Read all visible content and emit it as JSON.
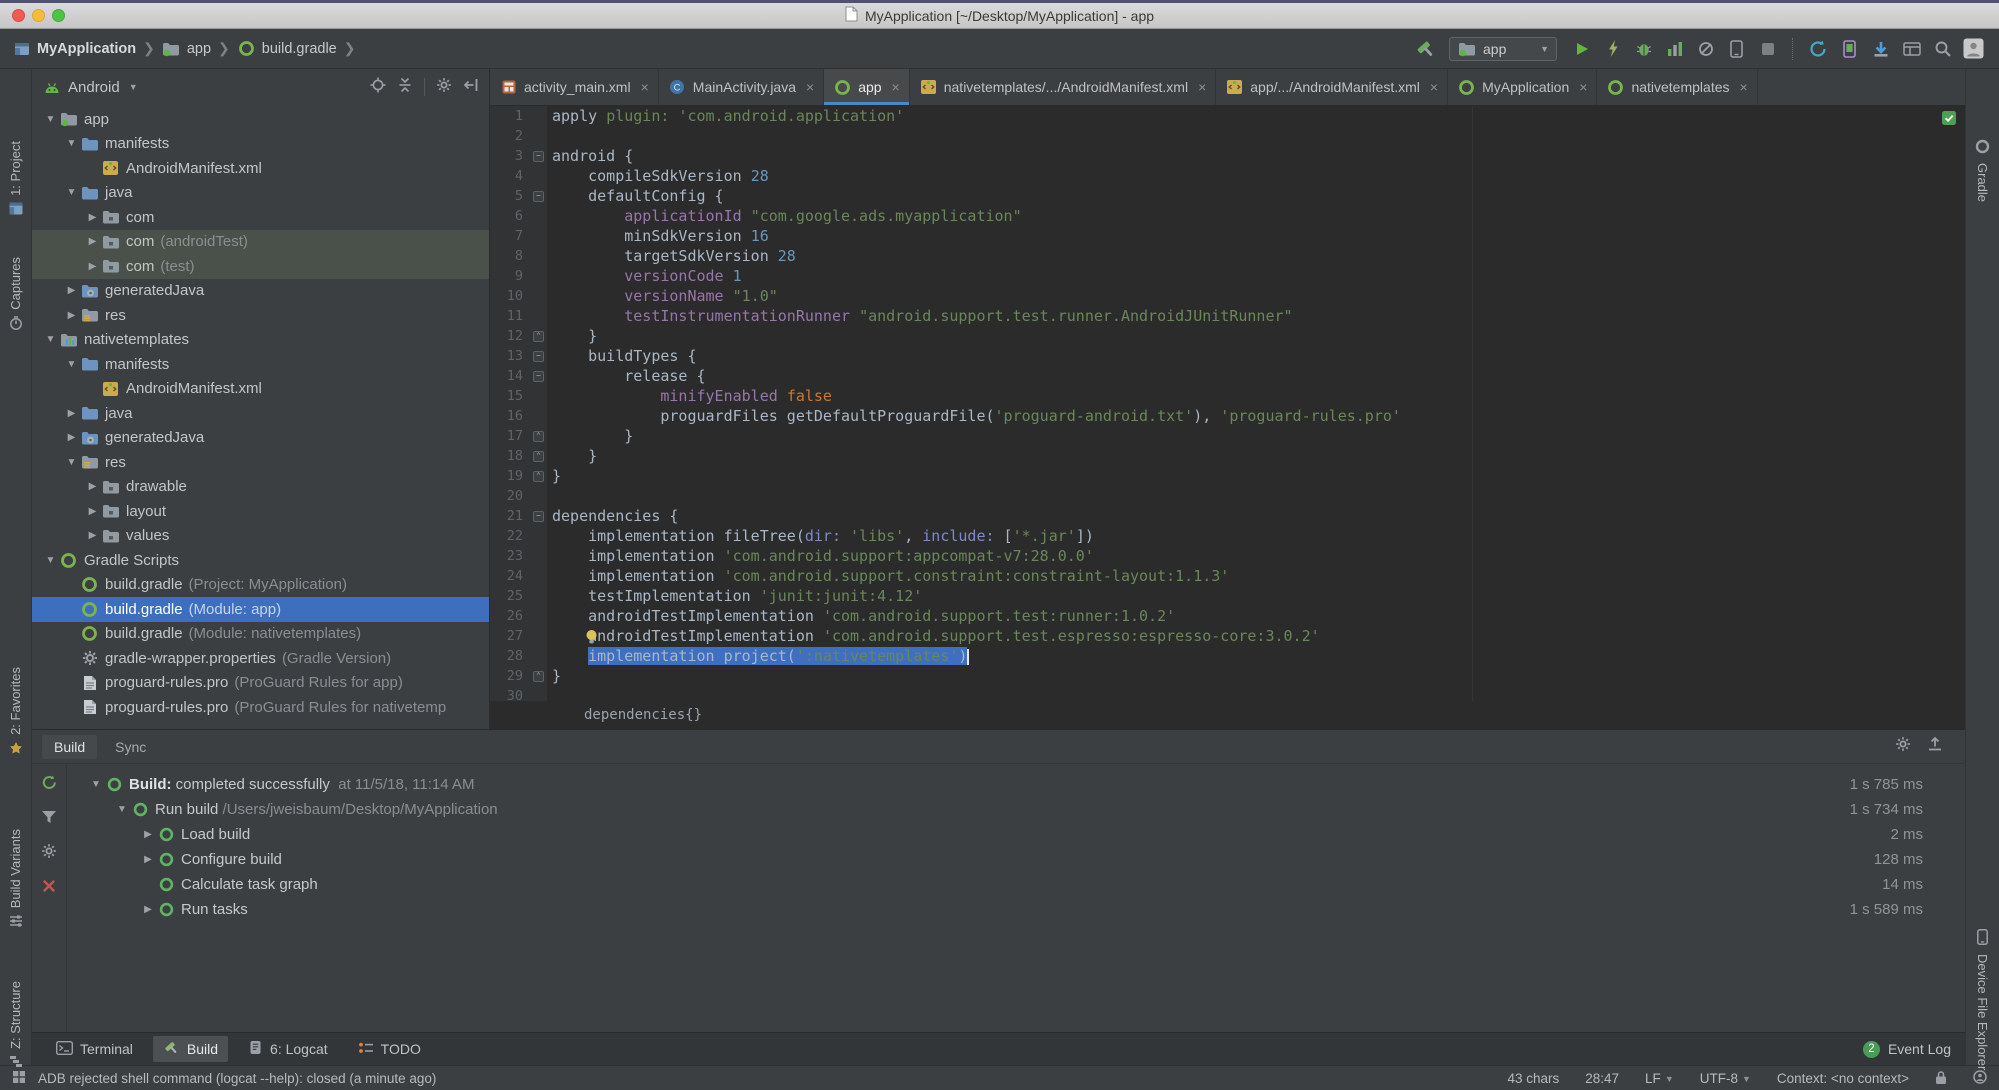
{
  "window": {
    "title": "MyApplication [~/Desktop/MyApplication] - app"
  },
  "toolbar": {
    "breadcrumbs": [
      "MyApplication",
      "app",
      "build.gradle"
    ],
    "run_config": "app",
    "icons": [
      "build-hammer",
      "run-config-selector",
      "run",
      "apply-changes",
      "debug",
      "profile",
      "attach-profiler",
      "select-device",
      "stop",
      "sync-gradle",
      "avd-manager",
      "sdk-manager",
      "project-structure",
      "search-everywhere",
      "user-avatar"
    ]
  },
  "left_stripe": {
    "items": [
      {
        "icon": "project-tool",
        "label": "1: Project"
      },
      {
        "icon": "captures-tool",
        "label": "Captures"
      },
      {
        "icon": "favorites-tool",
        "label": "2: Favorites"
      },
      {
        "icon": "variants-tool",
        "label": "Build Variants"
      },
      {
        "icon": "structure-tool",
        "label": "Z: Structure"
      }
    ]
  },
  "right_stripe": {
    "items": [
      {
        "icon": "gradle-tool",
        "label": "Gradle"
      },
      {
        "icon": "device-tool",
        "label": "Device File Explorer"
      }
    ]
  },
  "project_panel": {
    "view_selector": "Android",
    "tree": [
      {
        "d": 0,
        "a": "v",
        "i": "app",
        "l": "app"
      },
      {
        "d": 1,
        "a": "v",
        "i": "fblue",
        "l": "manifests"
      },
      {
        "d": 2,
        "a": "",
        "i": "manifest",
        "l": "AndroidManifest.xml"
      },
      {
        "d": 1,
        "a": "v",
        "i": "fblue",
        "l": "java"
      },
      {
        "d": 2,
        "a": "r",
        "i": "fpkg",
        "l": "com"
      },
      {
        "d": 2,
        "a": "r",
        "i": "fpkg",
        "l": "com",
        "n": "(androidTest)",
        "soft": true
      },
      {
        "d": 2,
        "a": "r",
        "i": "fpkg",
        "l": "com",
        "n": "(test)",
        "soft": true
      },
      {
        "d": 1,
        "a": "r",
        "i": "fgen",
        "l": "generatedJava"
      },
      {
        "d": 1,
        "a": "r",
        "i": "fres",
        "l": "res"
      },
      {
        "d": 0,
        "a": "v",
        "i": "mod",
        "l": "nativetemplates"
      },
      {
        "d": 1,
        "a": "v",
        "i": "fblue",
        "l": "manifests"
      },
      {
        "d": 2,
        "a": "",
        "i": "manifest",
        "l": "AndroidManifest.xml"
      },
      {
        "d": 1,
        "a": "r",
        "i": "fblue",
        "l": "java"
      },
      {
        "d": 1,
        "a": "r",
        "i": "fgen",
        "l": "generatedJava"
      },
      {
        "d": 1,
        "a": "v",
        "i": "fres",
        "l": "res"
      },
      {
        "d": 2,
        "a": "r",
        "i": "fpkg",
        "l": "drawable"
      },
      {
        "d": 2,
        "a": "r",
        "i": "fpkg",
        "l": "layout"
      },
      {
        "d": 2,
        "a": "r",
        "i": "fpkg",
        "l": "values"
      },
      {
        "d": 0,
        "a": "v",
        "i": "gradle",
        "l": "Gradle Scripts"
      },
      {
        "d": 1,
        "a": "",
        "i": "gradle",
        "l": "build.gradle",
        "n": "(Project: MyApplication)"
      },
      {
        "d": 1,
        "a": "",
        "i": "gradle",
        "l": "build.gradle",
        "n": "(Module: app)",
        "sel": true
      },
      {
        "d": 1,
        "a": "",
        "i": "gradle",
        "l": "build.gradle",
        "n": "(Module: nativetemplates)"
      },
      {
        "d": 1,
        "a": "",
        "i": "props",
        "l": "gradle-wrapper.properties",
        "n": "(Gradle Version)"
      },
      {
        "d": 1,
        "a": "",
        "i": "pro",
        "l": "proguard-rules.pro",
        "n": "(ProGuard Rules for app)"
      },
      {
        "d": 1,
        "a": "",
        "i": "pro",
        "l": "proguard-rules.pro",
        "n": "(ProGuard Rules for nativetemp"
      }
    ]
  },
  "editor": {
    "tabs": [
      {
        "icon": "layout",
        "label": "activity_main.xml"
      },
      {
        "icon": "jclass",
        "label": "MainActivity.java"
      },
      {
        "icon": "gradle",
        "label": "app",
        "selected": true
      },
      {
        "icon": "manifest",
        "label": "nativetemplates/.../AndroidManifest.xml"
      },
      {
        "icon": "manifest",
        "label": "app/.../AndroidManifest.xml"
      },
      {
        "icon": "gradle",
        "label": "MyApplication"
      },
      {
        "icon": "gradle",
        "label": "nativetemplates"
      }
    ],
    "context_line": "dependencies{}",
    "code": {
      "lines": [
        {
          "n": 1,
          "tokens": [
            {
              "t": "apply ",
              "c": "d"
            },
            {
              "t": "plugin:",
              "c": "g"
            },
            {
              "t": " ",
              "c": "d"
            },
            {
              "t": "'com.android.application'",
              "c": "s"
            }
          ]
        },
        {
          "n": 2,
          "tokens": []
        },
        {
          "n": 3,
          "f": "m",
          "tokens": [
            {
              "t": "android {",
              "c": "d"
            }
          ]
        },
        {
          "n": 4,
          "tokens": [
            {
              "t": "    compileSdkVersion ",
              "c": "d"
            },
            {
              "t": "28",
              "c": "n"
            }
          ]
        },
        {
          "n": 5,
          "f": "m",
          "tokens": [
            {
              "t": "    defaultConfig {",
              "c": "d"
            }
          ]
        },
        {
          "n": 6,
          "tokens": [
            {
              "t": "        ",
              "c": "d"
            },
            {
              "t": "applicationId ",
              "c": "p"
            },
            {
              "t": "\"com.google.ads.myapplication\"",
              "c": "s"
            }
          ]
        },
        {
          "n": 7,
          "tokens": [
            {
              "t": "        minSdkVersion ",
              "c": "d"
            },
            {
              "t": "16",
              "c": "n"
            }
          ]
        },
        {
          "n": 8,
          "tokens": [
            {
              "t": "        targetSdkVersion ",
              "c": "d"
            },
            {
              "t": "28",
              "c": "n"
            }
          ]
        },
        {
          "n": 9,
          "tokens": [
            {
              "t": "        ",
              "c": "d"
            },
            {
              "t": "versionCode ",
              "c": "p"
            },
            {
              "t": "1",
              "c": "n"
            }
          ]
        },
        {
          "n": 10,
          "tokens": [
            {
              "t": "        ",
              "c": "d"
            },
            {
              "t": "versionName ",
              "c": "p"
            },
            {
              "t": "\"1.0\"",
              "c": "s"
            }
          ]
        },
        {
          "n": 11,
          "tokens": [
            {
              "t": "        ",
              "c": "d"
            },
            {
              "t": "testInstrumentationRunner ",
              "c": "p"
            },
            {
              "t": "\"android.support.test.runner.AndroidJUnitRunner\"",
              "c": "s"
            }
          ]
        },
        {
          "n": 12,
          "f": "e",
          "tokens": [
            {
              "t": "    }",
              "c": "d"
            }
          ]
        },
        {
          "n": 13,
          "f": "m",
          "tokens": [
            {
              "t": "    buildTypes {",
              "c": "d"
            }
          ]
        },
        {
          "n": 14,
          "f": "m",
          "tokens": [
            {
              "t": "        release {",
              "c": "d"
            }
          ]
        },
        {
          "n": 15,
          "tokens": [
            {
              "t": "            ",
              "c": "d"
            },
            {
              "t": "minifyEnabled ",
              "c": "p"
            },
            {
              "t": "false",
              "c": "k"
            }
          ]
        },
        {
          "n": 16,
          "tokens": [
            {
              "t": "            proguardFiles getDefaultProguardFile(",
              "c": "d"
            },
            {
              "t": "'proguard-android.txt'",
              "c": "s"
            },
            {
              "t": "), ",
              "c": "d"
            },
            {
              "t": "'proguard-rules.pro'",
              "c": "s"
            }
          ]
        },
        {
          "n": 17,
          "f": "e",
          "tokens": [
            {
              "t": "        }",
              "c": "d"
            }
          ]
        },
        {
          "n": 18,
          "f": "e",
          "tokens": [
            {
              "t": "    }",
              "c": "d"
            }
          ]
        },
        {
          "n": 19,
          "f": "e",
          "tokens": [
            {
              "t": "}",
              "c": "d"
            }
          ]
        },
        {
          "n": 20,
          "tokens": []
        },
        {
          "n": 21,
          "f": "m",
          "tokens": [
            {
              "t": "dependencies {",
              "c": "d"
            }
          ]
        },
        {
          "n": 22,
          "tokens": [
            {
              "t": "    implementation fileTree(",
              "c": "d"
            },
            {
              "t": "dir:",
              "c": "a"
            },
            {
              "t": " ",
              "c": "d"
            },
            {
              "t": "'libs'",
              "c": "s"
            },
            {
              "t": ", ",
              "c": "d"
            },
            {
              "t": "include:",
              "c": "a"
            },
            {
              "t": " [",
              "c": "d"
            },
            {
              "t": "'*.jar'",
              "c": "s"
            },
            {
              "t": "])",
              "c": "d"
            }
          ]
        },
        {
          "n": 23,
          "tokens": [
            {
              "t": "    implementation ",
              "c": "d"
            },
            {
              "t": "'com.android.support:appcompat-v7:28.0.0'",
              "c": "s"
            }
          ]
        },
        {
          "n": 24,
          "tokens": [
            {
              "t": "    implementation ",
              "c": "d"
            },
            {
              "t": "'com.android.support.constraint:constraint-layout:1.1.3'",
              "c": "s"
            }
          ]
        },
        {
          "n": 25,
          "tokens": [
            {
              "t": "    testImplementation ",
              "c": "d"
            },
            {
              "t": "'junit:junit:4.12'",
              "c": "s"
            }
          ]
        },
        {
          "n": 26,
          "tokens": [
            {
              "t": "    androidTestImplementation ",
              "c": "d"
            },
            {
              "t": "'com.android.support.test:runner:1.0.2'",
              "c": "s"
            }
          ]
        },
        {
          "n": 27,
          "bulb": true,
          "tokens": [
            {
              "t": "    androidTestImplementation ",
              "c": "d"
            },
            {
              "t": "'com.android.support.test.espresso:espresso-core:3.0.2'",
              "c": "s"
            }
          ]
        },
        {
          "n": 28,
          "caret": true,
          "tokens": [
            {
              "t": "    ",
              "c": "d"
            },
            {
              "t": "implementation project(",
              "c": "d",
              "h": 1
            },
            {
              "t": "':nativetemplates'",
              "c": "s",
              "h": 1
            },
            {
              "t": ")",
              "c": "d",
              "h": 1
            }
          ]
        },
        {
          "n": 29,
          "f": "e",
          "tokens": [
            {
              "t": "}",
              "c": "d"
            }
          ]
        },
        {
          "n": 30,
          "tokens": []
        }
      ]
    }
  },
  "build_panel": {
    "tabs": [
      {
        "label": "Build",
        "selected": true
      },
      {
        "label": "Sync",
        "selected": false
      }
    ],
    "left_icons": [
      "rerun-build",
      "filter",
      "settings",
      "close"
    ],
    "rows": [
      {
        "ind": 0,
        "a": "v",
        "segs": [
          {
            "t": "Build: ",
            "c": "b"
          },
          {
            "t": "completed successfully",
            "c": "w"
          },
          {
            "t": "  at 11/5/18, 11:14 AM",
            "c": "g"
          }
        ],
        "time": "1 s 785 ms"
      },
      {
        "ind": 1,
        "a": "v",
        "segs": [
          {
            "t": "Run build ",
            "c": "w"
          },
          {
            "t": "/Users/jweisbaum/Desktop/MyApplication",
            "c": "g"
          }
        ],
        "time": "1 s 734 ms"
      },
      {
        "ind": 2,
        "a": "r",
        "segs": [
          {
            "t": "Load build",
            "c": "w"
          }
        ],
        "time": "2 ms"
      },
      {
        "ind": 2,
        "a": "r",
        "segs": [
          {
            "t": "Configure build",
            "c": "w"
          }
        ],
        "time": "128 ms"
      },
      {
        "ind": 2,
        "a": "",
        "segs": [
          {
            "t": "Calculate task graph",
            "c": "w"
          }
        ],
        "time": "14 ms"
      },
      {
        "ind": 2,
        "a": "r",
        "segs": [
          {
            "t": "Run tasks",
            "c": "w"
          }
        ],
        "time": "1 s 589 ms"
      }
    ]
  },
  "bottom_bar": {
    "items": [
      {
        "icon": "terminal",
        "label": "Terminal"
      },
      {
        "icon": "hammer-small",
        "label": "Build",
        "selected": true
      },
      {
        "icon": "logcat",
        "label": "6: Logcat"
      },
      {
        "icon": "todo",
        "label": "TODO"
      }
    ],
    "event_log": {
      "badge": "2",
      "label": "Event Log"
    }
  },
  "status_bar": {
    "message": "ADB rejected shell command (logcat --help): closed (a minute ago)",
    "right": [
      {
        "label": "43 chars"
      },
      {
        "label": "28:47"
      },
      {
        "label": "LF",
        "chevron": true
      },
      {
        "label": "UTF-8",
        "chevron": true
      },
      {
        "label": "Context: <no context>"
      }
    ],
    "right_icons": [
      "lock",
      "inspections-profile"
    ]
  },
  "colors": {
    "selection_blue": "#3d6fbe",
    "code_selection": "#3f6fc1",
    "string_green": "#6a8759",
    "number_blue": "#6897bb",
    "keyword_orange": "#cc7832",
    "property_purple": "#9876aa",
    "run_green": "#62b543",
    "error_red": "#c75450",
    "badge_green": "#499c54"
  }
}
